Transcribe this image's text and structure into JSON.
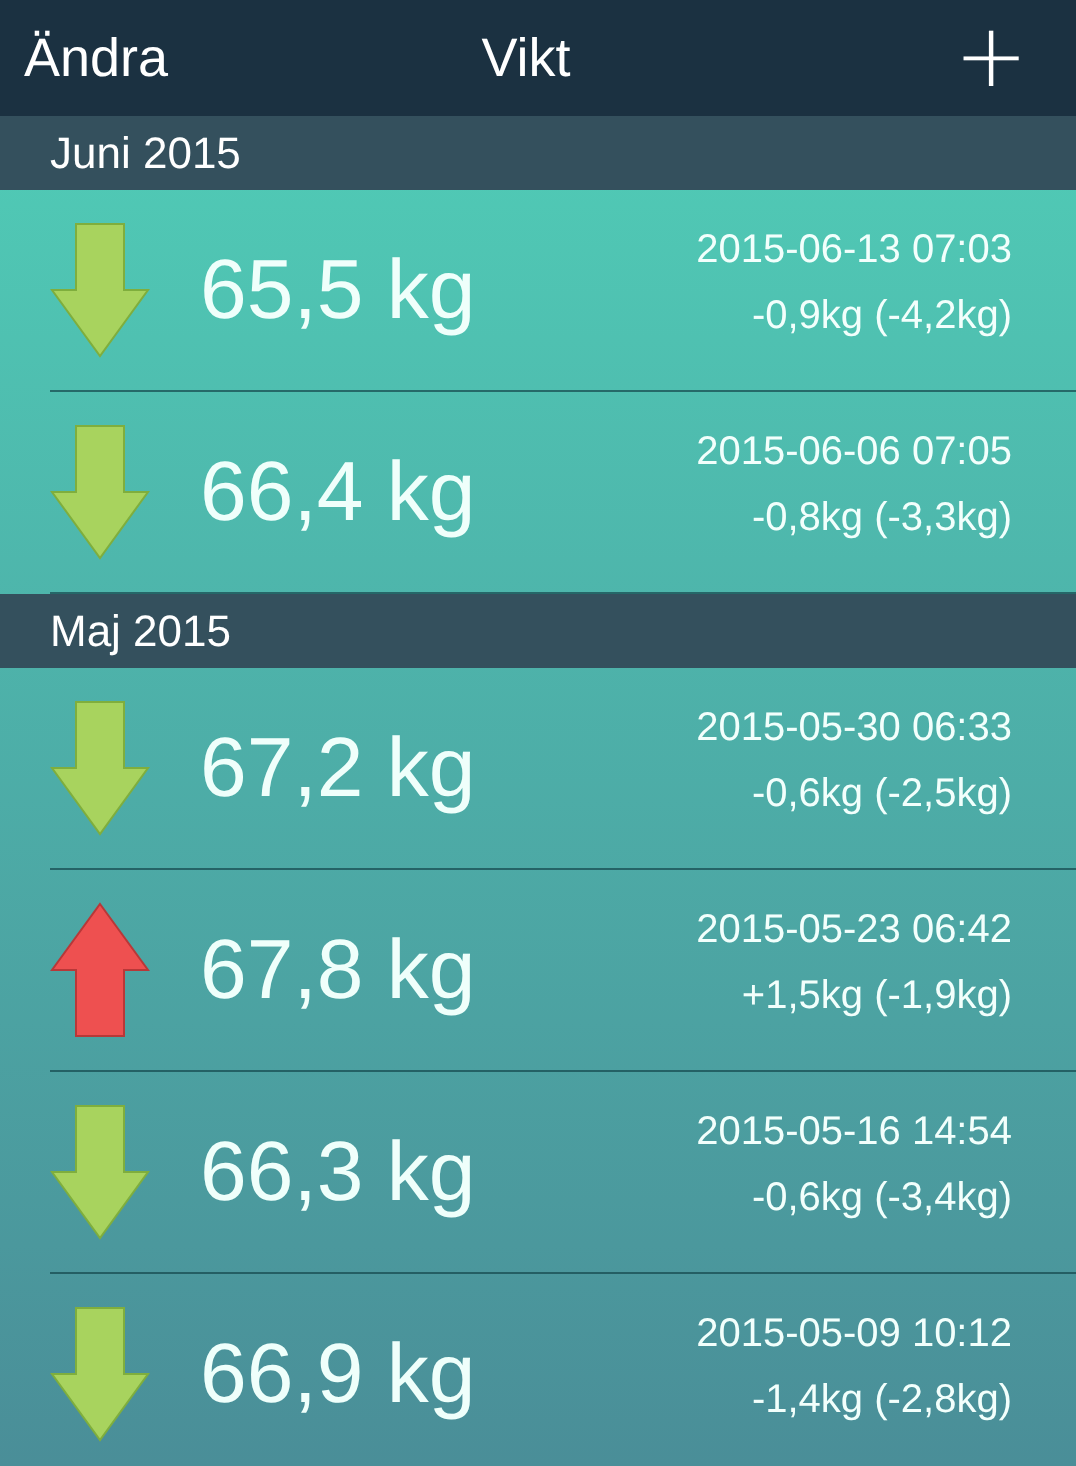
{
  "nav": {
    "left": "Ändra",
    "title": "Vikt",
    "right": "+"
  },
  "sections": [
    {
      "title": "Juni 2015",
      "entries": [
        {
          "kind": "down",
          "weight": "65,5 kg",
          "date": "2015-06-13 07:03",
          "change": "-0,9kg (-4,2kg)"
        },
        {
          "kind": "down",
          "weight": "66,4 kg",
          "date": "2015-06-06 07:05",
          "change": "-0,8kg (-3,3kg)"
        }
      ]
    },
    {
      "title": "Maj 2015",
      "entries": [
        {
          "kind": "down",
          "weight": "67,2 kg",
          "date": "2015-05-30 06:33",
          "change": "-0,6kg (-2,5kg)"
        },
        {
          "kind": "up",
          "weight": "67,8 kg",
          "date": "2015-05-23 06:42",
          "change": "+1,5kg (-1,9kg)"
        },
        {
          "kind": "down",
          "weight": "66,3 kg",
          "date": "2015-05-16 14:54",
          "change": "-0,6kg (-3,4kg)"
        },
        {
          "kind": "down",
          "weight": "66,9 kg",
          "date": "2015-05-09 10:12",
          "change": "-1,4kg (-2,8kg)"
        }
      ]
    }
  ]
}
